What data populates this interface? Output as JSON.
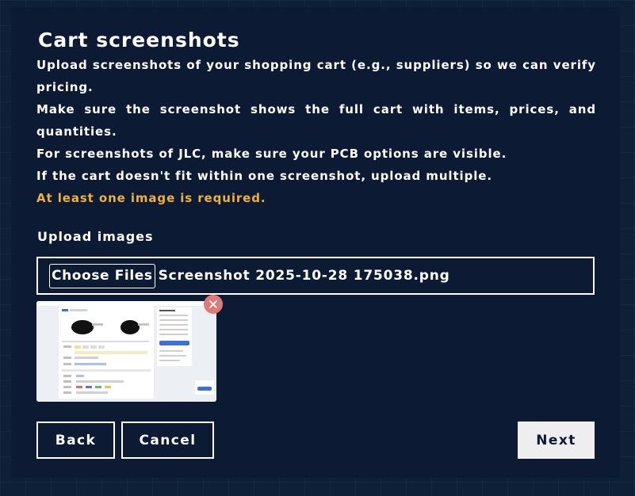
{
  "dialog": {
    "title": "Cart screenshots",
    "instructions": [
      "Upload screenshots of your shopping cart (e.g., suppliers) so we can verify pricing.",
      "Make sure the screenshot shows the full cart with items, prices, and quantities.",
      "For screenshots of JLC, make sure your PCB options are visible.",
      "If the cart doesn't fit within one screenshot, upload multiple."
    ],
    "requirement": "At least one image is required.",
    "upload_label": "Upload images",
    "file_input": {
      "button_label": "Choose Files",
      "file_name": "Screenshot 2025-10-28 175038.png"
    },
    "buttons": {
      "back": "Back",
      "cancel": "Cancel",
      "next": "Next"
    }
  },
  "colors": {
    "background": "#0e1f38",
    "panel": "#0c1a34",
    "warning": "#f0b13c",
    "remove": "#e07a7a"
  },
  "icons": {
    "remove": "close-icon"
  }
}
